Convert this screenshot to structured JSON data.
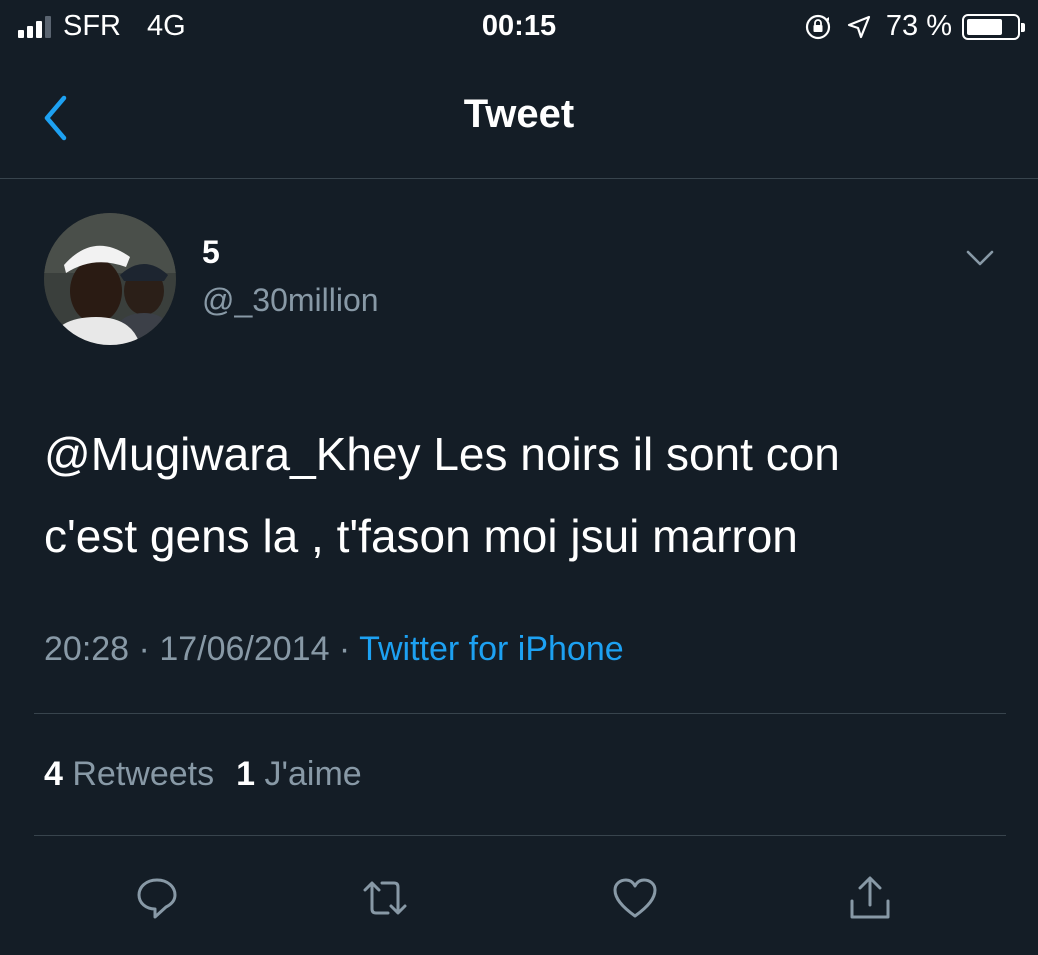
{
  "status_bar": {
    "carrier": "SFR",
    "network": "4G",
    "time": "00:15",
    "battery_text": "73 %",
    "battery_level": 0.73,
    "icons": [
      "signal-icon",
      "rotation-lock-icon",
      "location-arrow-icon",
      "battery-icon"
    ]
  },
  "nav": {
    "title": "Tweet",
    "back_icon": "chevron-left-icon"
  },
  "tweet": {
    "author": {
      "display_name": "5",
      "handle": "@_30million"
    },
    "mention": "@Mugiwara_Khey",
    "line1_rest": " Les noirs il sont con",
    "line2": "c'est gens la , t'fason moi jsui marron",
    "time": "20:28",
    "date": "17/06/2014",
    "separator": " · ",
    "source": "Twitter for iPhone",
    "stats": {
      "retweets_count": "4",
      "retweets_label": "Retweets",
      "likes_count": "1",
      "likes_label": "J'aime"
    }
  },
  "actions": [
    {
      "name": "reply",
      "icon": "reply-icon"
    },
    {
      "name": "retweet",
      "icon": "retweet-icon"
    },
    {
      "name": "like",
      "icon": "heart-icon"
    },
    {
      "name": "share",
      "icon": "share-icon"
    }
  ],
  "colors": {
    "background": "#141d26",
    "text_primary": "#ffffff",
    "text_secondary": "#8899a6",
    "accent": "#1da1f2",
    "divider": "#38444d"
  }
}
